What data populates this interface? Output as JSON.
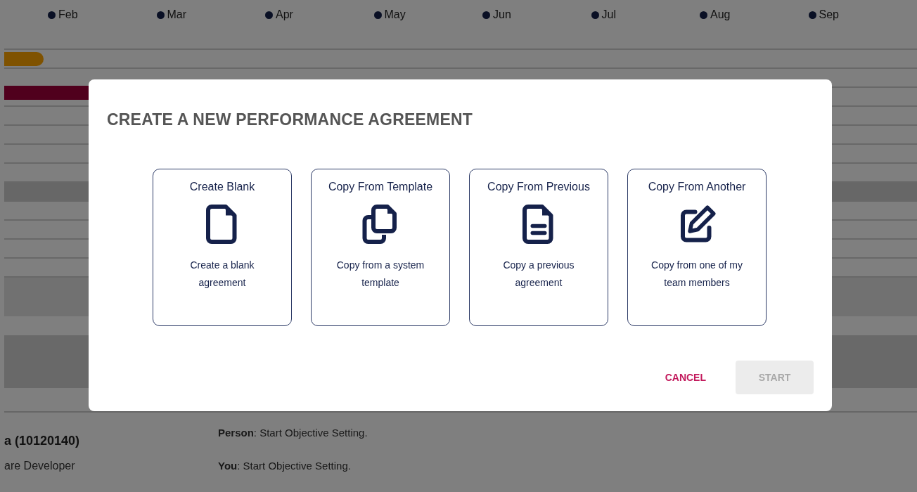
{
  "timeline": {
    "months": [
      "Feb",
      "Mar",
      "Apr",
      "May",
      "Jun",
      "Jul",
      "Aug",
      "Sep"
    ]
  },
  "employee": {
    "name": "a (10120140)",
    "role": "are Developer"
  },
  "status_lines": [
    {
      "label": "Person",
      "text": ": Start Objective Setting."
    },
    {
      "label": "You",
      "text": ": Start Objective Setting."
    }
  ],
  "dialog": {
    "title": "CREATE A NEW PERFORMANCE AGREEMENT",
    "options": [
      {
        "title": "Create Blank",
        "description": "Create a blank agreement",
        "selected": false
      },
      {
        "title": "Copy From Template",
        "description": "Copy from a system template",
        "selected": false
      },
      {
        "title": "Copy From Previous",
        "description": "Copy a previous agreement",
        "selected": false
      },
      {
        "title": "Copy From Another",
        "description": "Copy from one of my team members",
        "selected": false
      }
    ],
    "cancel": {
      "label": "CANCEL"
    },
    "start": {
      "label": "START",
      "disabled": true
    }
  }
}
